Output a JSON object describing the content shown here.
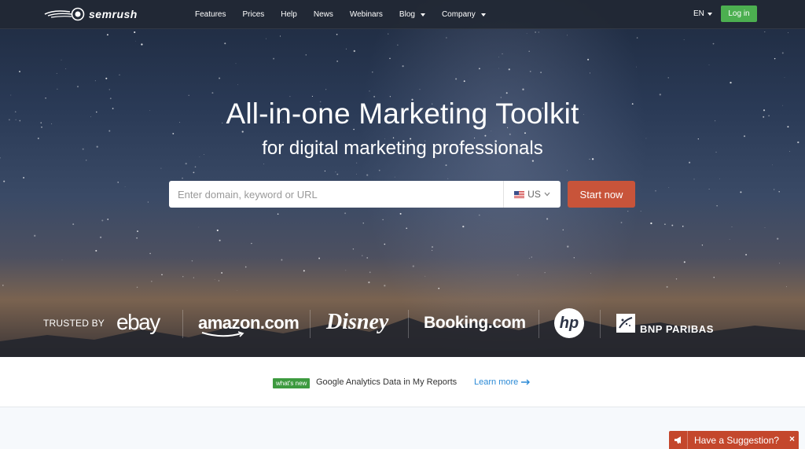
{
  "brand": {
    "name": "semrush"
  },
  "nav": {
    "links": [
      {
        "label": "Features",
        "dropdown": false
      },
      {
        "label": "Prices",
        "dropdown": false
      },
      {
        "label": "Help",
        "dropdown": false
      },
      {
        "label": "News",
        "dropdown": false
      },
      {
        "label": "Webinars",
        "dropdown": false
      },
      {
        "label": "Blog",
        "dropdown": true
      },
      {
        "label": "Company",
        "dropdown": true
      }
    ],
    "language": "EN",
    "login_label": "Log in"
  },
  "hero": {
    "title": "All-in-one Marketing Toolkit",
    "subtitle": "for digital marketing professionals",
    "search": {
      "placeholder": "Enter domain, keyword or URL",
      "database": "US",
      "button_label": "Start now"
    }
  },
  "trusted": {
    "label": "TRUSTED BY",
    "logos": [
      "ebay",
      "amazon.com",
      "Disney",
      "Booking.com",
      "hp",
      "BNP PARIBAS"
    ]
  },
  "whats_new": {
    "badge": "what's new",
    "text": "Google Analytics Data in My Reports",
    "link_label": "Learn more"
  },
  "suggestion": {
    "label": "Have a Suggestion?",
    "close": "×"
  },
  "colors": {
    "nav_bg": "#222834",
    "login_green": "#4caf50",
    "cta_orange": "#c8543a",
    "link_blue": "#2b8ad6",
    "badge_green": "#3d9a3f",
    "suggest_red": "#c4472c"
  },
  "icons": {
    "logo": "semrush-fireball-icon",
    "flag": "us-flag-icon",
    "chevron": "chevron-down-icon",
    "arrow": "arrow-right-icon",
    "megaphone": "megaphone-icon"
  }
}
